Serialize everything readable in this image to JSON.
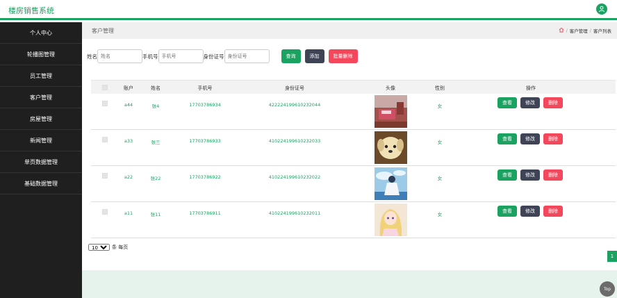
{
  "app": {
    "title": "楼房销售系统"
  },
  "colors": {
    "brand": "#1aa260",
    "danger": "#f5475c",
    "dark": "#3e4455",
    "sidebar": "#1f1f1f"
  },
  "header": {
    "user_icon": "user-icon"
  },
  "sidebar": {
    "items": [
      {
        "label": "个人中心"
      },
      {
        "label": "轮播图管理"
      },
      {
        "label": "员工管理"
      },
      {
        "label": "客户管理"
      },
      {
        "label": "房屋管理"
      },
      {
        "label": "新闻管理"
      },
      {
        "label": "单页数据管理"
      },
      {
        "label": "基础数据管理"
      }
    ]
  },
  "page": {
    "title": "客户管理",
    "breadcrumb": {
      "home_icon": "home-icon",
      "items": [
        "客户管理",
        "客户列表"
      ],
      "separator": "/"
    }
  },
  "filters": {
    "name_label": "姓名",
    "name_placeholder": "姓名",
    "phone_label": "手机号",
    "phone_placeholder": "手机号",
    "idcard_label": "身份证号",
    "idcard_placeholder": "身份证号",
    "search_button": "查询",
    "add_button": "添加",
    "batch_delete_button": "批量删除"
  },
  "table": {
    "columns": [
      "账户",
      "姓名",
      "手机号",
      "身份证号",
      "头像",
      "性别",
      "操作"
    ],
    "rows": [
      {
        "account": "a44",
        "name": "张4",
        "phone": "17703786934",
        "idcard": "422224199610232044",
        "gender": "女",
        "avatar": "bedroom-photo"
      },
      {
        "account": "a33",
        "name": "张三",
        "phone": "17703786933",
        "idcard": "410224199610232033",
        "gender": "女",
        "avatar": "puppy-photo"
      },
      {
        "account": "a22",
        "name": "张22",
        "phone": "17703786922",
        "idcard": "410224199610232022",
        "gender": "女",
        "avatar": "anime-sky-photo"
      },
      {
        "account": "a11",
        "name": "张11",
        "phone": "17703786911",
        "idcard": "410224199610232011",
        "gender": "女",
        "avatar": "anime-girl-photo"
      }
    ],
    "actions": {
      "view": "查看",
      "edit": "修改",
      "delete": "删除"
    }
  },
  "pagination": {
    "page_size": "10",
    "page_size_suffix": "条 每页",
    "current_page": "1"
  },
  "top_button": "Top"
}
